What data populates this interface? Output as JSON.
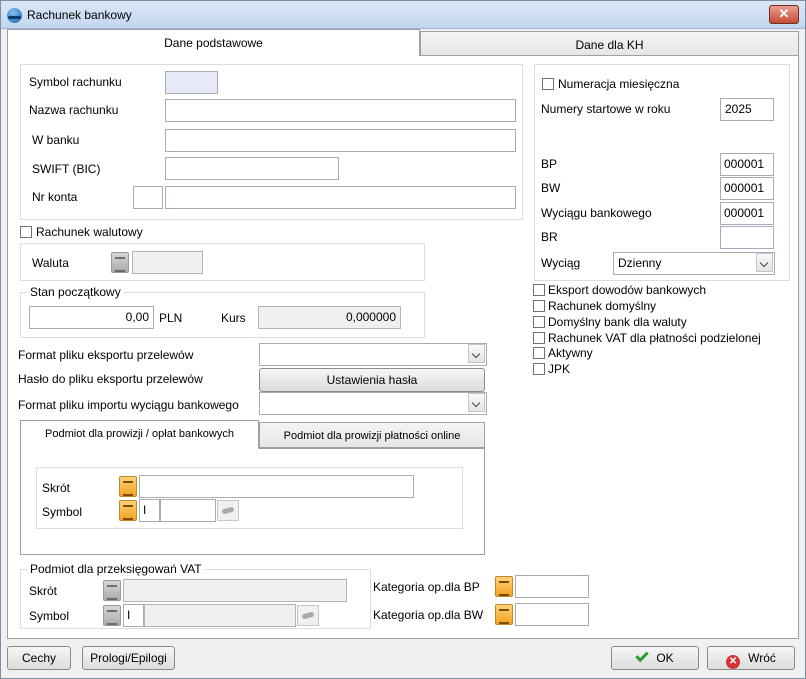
{
  "window": {
    "title": "Rachunek bankowy",
    "close": "✕"
  },
  "tabs": [
    {
      "label": "Dane podstawowe",
      "active": true
    },
    {
      "label": "Dane dla KH",
      "active": false
    }
  ],
  "account": {
    "symbol_label": "Symbol rachunku",
    "symbol_value": "",
    "name_label": "Nazwa rachunku",
    "name_value": "",
    "bank_label": "W banku",
    "bank_value": "",
    "swift_label": "SWIFT (BIC)",
    "swift_value": "",
    "number_label": "Nr konta",
    "number_prefix": "",
    "number_value": ""
  },
  "currency": {
    "checkbox_label": "Rachunek walutowy",
    "checked": false,
    "waluta_label": "Waluta",
    "waluta_value": ""
  },
  "initial": {
    "legend": "Stan początkowy",
    "amount": "0,00",
    "currency": "PLN",
    "kurs_label": "Kurs",
    "kurs_value": "0,000000"
  },
  "export": {
    "format_label": "Format pliku eksportu przelewów",
    "format_value": "",
    "password_label": "Hasło do pliku eksportu przelewów",
    "password_button": "Ustawienia hasła",
    "import_label": "Format pliku importu wyciągu bankowego",
    "import_value": ""
  },
  "subtabs": [
    {
      "label": "Podmiot dla prowizji / opłat bankowych",
      "active": true
    },
    {
      "label": "Podmiot dla prowizji płatności online",
      "active": false
    }
  ],
  "fee_entity": {
    "skrot_label": "Skrót",
    "skrot_value": "",
    "symbol_label": "Symbol",
    "symbol_prefix": "I",
    "symbol_value": ""
  },
  "vat": {
    "legend": "Podmiot dla przeksięgowań VAT",
    "skrot_label": "Skrót",
    "skrot_value": "",
    "symbol_label": "Symbol",
    "symbol_prefix": "I",
    "symbol_value": "",
    "kat_bp_label": "Kategoria op.dla BP",
    "kat_bp_value": "",
    "kat_bw_label": "Kategoria op.dla BW",
    "kat_bw_value": ""
  },
  "numbering": {
    "monthly_label": "Numeracja miesięczna",
    "monthly_checked": false,
    "start_label": "Numery startowe w roku",
    "year": "2025",
    "bp_label": "BP",
    "bp_value": "000001",
    "bw_label": "BW",
    "bw_value": "000001",
    "wyciag_label": "Wyciągu bankowego",
    "wyciag_value": "000001",
    "br_label": "BR",
    "br_value": "",
    "period_label": "Wyciąg",
    "period_value": "Dzienny"
  },
  "options": [
    {
      "label": "Eksport dowodów bankowych",
      "checked": false
    },
    {
      "label": "Rachunek domyślny",
      "checked": false
    },
    {
      "label": "Domyślny bank dla waluty",
      "checked": false
    },
    {
      "label": "Rachunek VAT dla płatności podzielonej",
      "checked": false
    },
    {
      "label": "Aktywny",
      "checked": false
    },
    {
      "label": "JPK",
      "checked": false
    }
  ],
  "footer": {
    "cechy": "Cechy",
    "prologi": "Prologi/Epilogi",
    "ok": "OK",
    "cancel": "Wróć"
  }
}
